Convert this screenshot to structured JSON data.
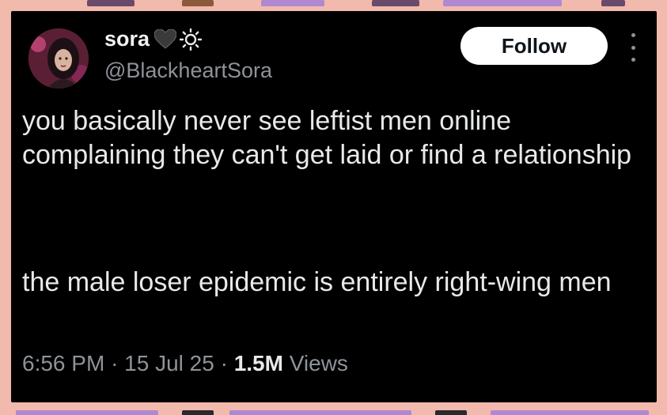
{
  "tweet": {
    "display_name": "sora",
    "name_emoji": [
      "black-heart",
      "sun"
    ],
    "handle": "@BlackheartSora",
    "follow_label": "Follow",
    "paragraphs": [
      "you basically never see leftist men online complaining they can't get laid or find a relationship",
      "the male loser epidemic is entirely right-wing men"
    ],
    "time": "6:56 PM",
    "separator": "·",
    "date": "15 Jul 25",
    "views_count": "1.5M",
    "views_label": "Views"
  },
  "colors": {
    "background": "#000000",
    "frame": "#f2b9ad",
    "text_primary": "#e7e9ea",
    "text_secondary": "#8e9399",
    "follow_bg": "#ffffff",
    "follow_text": "#0f1419"
  }
}
